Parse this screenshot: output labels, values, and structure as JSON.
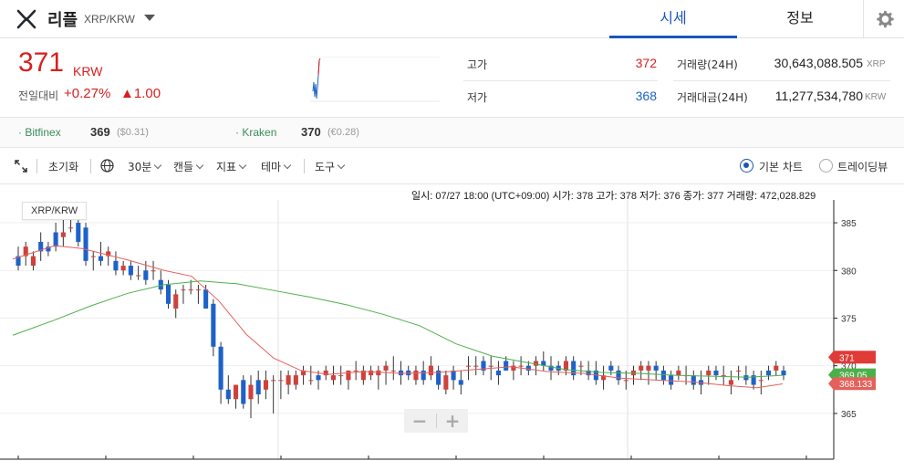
{
  "header": {
    "coin_name": "리플",
    "coin_pair": "XRP/KRW",
    "tabs": [
      {
        "label": "시세",
        "active": true
      },
      {
        "label": "정보",
        "active": false
      }
    ]
  },
  "price": {
    "current": "371",
    "unit": "KRW",
    "change_label": "전일대비",
    "change_pct": "+0.27%",
    "change_amt": "▲1.00"
  },
  "stats": {
    "high_label": "고가",
    "high": "372",
    "low_label": "저가",
    "low": "368",
    "volume_label": "거래량(24H)",
    "volume": "30,643,088.505",
    "volume_unit": "XRP",
    "value_label": "거래대금(24H)",
    "value": "11,277,534,780",
    "value_unit": "KRW"
  },
  "exchanges": [
    {
      "name": "Bitfinex",
      "price": "369",
      "sub": "($0.31)"
    },
    {
      "name": "Kraken",
      "price": "370",
      "sub": "(€0.28)"
    }
  ],
  "toolbar": {
    "reset": "초기화",
    "interval": "30분",
    "candle": "캔들",
    "indicator": "지표",
    "theme": "테마",
    "tools": "도구",
    "view_basic": "기본 차트",
    "view_tv": "트레이딩뷰"
  },
  "ohlc": {
    "time_label": "일시:",
    "time": "07/27 18:00 (UTC+09:00)",
    "open_label": "시가:",
    "open": "378",
    "high_label": "고가:",
    "high": "378",
    "low_label": "저가:",
    "low": "376",
    "close_label": "종가:",
    "close": "377",
    "vol_label": "거래량:",
    "vol": "472,028.829"
  },
  "colors": {
    "up": "#d0413b",
    "down": "#1e62c8",
    "ma_short": "#e5605a",
    "ma_long": "#4cb04a",
    "accent": "#1a56b8"
  },
  "chart_data": {
    "type": "candlestick",
    "symbol": "XRP/KRW",
    "ylim": [
      360.2,
      387.4
    ],
    "yticks": [
      365,
      370,
      375,
      380,
      385
    ],
    "price_tags": [
      {
        "label": "371",
        "value": 370.9,
        "color": "#e03b36"
      },
      {
        "label": "369.05",
        "value": 369.05,
        "color": "#4cb04a"
      },
      {
        "label": "368.133",
        "value": 368.13,
        "color": "#e5605a"
      }
    ],
    "candles": [
      [
        381.5,
        382.5,
        380.0,
        380.5
      ],
      [
        381.5,
        383.0,
        380.5,
        382.5
      ],
      [
        380.5,
        382.0,
        380.0,
        381.5
      ],
      [
        383.0,
        384.0,
        381.0,
        382.0
      ],
      [
        382.5,
        383.0,
        381.5,
        382.0
      ],
      [
        384.0,
        385.0,
        382.0,
        382.5
      ],
      [
        383.5,
        385.5,
        382.5,
        384.0
      ],
      [
        384.5,
        386.5,
        384.0,
        384.5
      ],
      [
        385.0,
        385.5,
        382.5,
        383.0
      ],
      [
        384.5,
        385.0,
        380.5,
        381.0
      ],
      [
        381.5,
        382.0,
        380.0,
        381.5
      ],
      [
        381.5,
        383.0,
        380.5,
        381.0
      ],
      [
        381.5,
        382.5,
        380.5,
        382.0
      ],
      [
        381.0,
        382.0,
        379.5,
        380.0
      ],
      [
        380.0,
        381.0,
        379.5,
        380.5
      ],
      [
        380.5,
        381.0,
        379.0,
        379.5
      ],
      [
        379.5,
        380.5,
        379.0,
        379.5
      ],
      [
        380.0,
        381.0,
        378.5,
        379.0
      ],
      [
        380.0,
        381.0,
        379.0,
        380.0
      ],
      [
        379.0,
        380.0,
        377.5,
        378.0
      ],
      [
        378.5,
        379.0,
        376.0,
        376.5
      ],
      [
        376.0,
        378.0,
        375.0,
        377.5
      ],
      [
        378.0,
        378.5,
        376.5,
        378.0
      ],
      [
        378.0,
        379.0,
        377.5,
        378.0
      ],
      [
        378.0,
        378.5,
        376.5,
        378.0
      ],
      [
        378.0,
        378.5,
        376.0,
        376.0
      ],
      [
        376.5,
        377.0,
        371.0,
        372.0
      ],
      [
        372.0,
        372.5,
        366.0,
        367.5
      ],
      [
        367.5,
        369.0,
        366.0,
        366.5
      ],
      [
        366.5,
        368.0,
        365.5,
        368.0
      ],
      [
        368.5,
        369.0,
        365.5,
        366.0
      ],
      [
        366.5,
        369.0,
        364.5,
        368.0
      ],
      [
        368.5,
        369.5,
        366.0,
        367.0
      ],
      [
        367.5,
        369.5,
        366.5,
        368.5
      ],
      [
        368.5,
        369.0,
        365.0,
        368.5
      ],
      [
        368.5,
        369.5,
        366.5,
        368.5
      ],
      [
        368.0,
        369.5,
        367.0,
        369.0
      ],
      [
        368.0,
        369.5,
        367.5,
        369.0
      ],
      [
        369.0,
        370.0,
        368.0,
        369.5
      ],
      [
        368.5,
        370.0,
        368.0,
        368.5
      ],
      [
        369.0,
        369.5,
        367.5,
        368.5
      ],
      [
        369.0,
        370.0,
        368.5,
        369.5
      ],
      [
        368.5,
        370.0,
        368.0,
        369.0
      ],
      [
        369.0,
        370.0,
        368.0,
        369.0
      ],
      [
        368.5,
        369.5,
        367.5,
        369.5
      ],
      [
        369.5,
        370.5,
        368.5,
        369.5
      ],
      [
        368.5,
        370.0,
        368.0,
        369.5
      ],
      [
        369.0,
        370.0,
        368.5,
        369.5
      ],
      [
        369.0,
        370.0,
        367.5,
        369.5
      ],
      [
        369.5,
        370.5,
        368.0,
        370.0
      ],
      [
        369.5,
        371.0,
        368.5,
        369.5
      ],
      [
        369.5,
        370.5,
        368.0,
        369.0
      ],
      [
        369.5,
        370.0,
        368.5,
        369.0
      ],
      [
        368.5,
        370.0,
        368.0,
        369.5
      ],
      [
        369.5,
        370.5,
        368.0,
        368.5
      ],
      [
        369.0,
        371.0,
        368.5,
        370.0
      ],
      [
        369.5,
        370.0,
        367.5,
        368.0
      ],
      [
        367.5,
        369.5,
        367.0,
        369.0
      ],
      [
        369.5,
        370.0,
        367.5,
        368.5
      ],
      [
        368.5,
        369.5,
        367.0,
        368.0
      ],
      [
        370.0,
        371.0,
        368.5,
        370.0
      ],
      [
        370.0,
        371.0,
        369.0,
        370.0
      ],
      [
        370.5,
        371.0,
        369.0,
        369.5
      ],
      [
        370.0,
        371.0,
        368.5,
        370.0
      ],
      [
        369.5,
        370.5,
        368.0,
        369.0
      ],
      [
        370.5,
        371.0,
        369.5,
        369.5
      ],
      [
        369.5,
        370.5,
        368.5,
        370.0
      ],
      [
        370.0,
        371.0,
        369.0,
        370.0
      ],
      [
        370.0,
        370.5,
        369.0,
        369.5
      ],
      [
        370.0,
        371.0,
        369.0,
        370.5
      ],
      [
        370.5,
        371.5,
        369.5,
        370.0
      ],
      [
        370.0,
        371.0,
        368.5,
        369.5
      ],
      [
        370.0,
        370.5,
        369.0,
        369.5
      ],
      [
        369.5,
        371.0,
        369.0,
        370.5
      ],
      [
        370.5,
        371.0,
        368.5,
        369.0
      ],
      [
        370.0,
        370.5,
        369.0,
        370.0
      ],
      [
        369.5,
        370.5,
        368.5,
        369.0
      ],
      [
        369.5,
        370.5,
        368.0,
        368.5
      ],
      [
        368.5,
        370.0,
        367.5,
        369.0
      ],
      [
        370.0,
        370.5,
        369.0,
        369.5
      ],
      [
        369.5,
        370.0,
        368.0,
        368.5
      ],
      [
        368.5,
        369.5,
        367.5,
        368.5
      ],
      [
        369.0,
        370.0,
        368.0,
        369.5
      ],
      [
        369.5,
        370.5,
        368.5,
        370.0
      ],
      [
        369.5,
        370.5,
        368.0,
        370.0
      ],
      [
        370.0,
        370.5,
        368.5,
        369.5
      ],
      [
        369.5,
        370.0,
        368.0,
        368.5
      ],
      [
        369.0,
        369.5,
        367.5,
        368.0
      ],
      [
        369.0,
        370.0,
        368.5,
        369.5
      ],
      [
        369.0,
        370.0,
        368.0,
        369.0
      ],
      [
        369.0,
        369.5,
        367.5,
        368.0
      ],
      [
        368.5,
        369.5,
        367.0,
        368.0
      ],
      [
        369.0,
        370.0,
        368.0,
        369.5
      ],
      [
        369.5,
        370.0,
        368.5,
        369.0
      ],
      [
        369.0,
        370.0,
        368.0,
        369.0
      ],
      [
        368.0,
        369.5,
        367.0,
        368.5
      ],
      [
        369.5,
        370.0,
        368.5,
        369.5
      ],
      [
        369.0,
        370.0,
        368.0,
        368.5
      ],
      [
        369.0,
        369.5,
        367.5,
        368.0
      ],
      [
        368.5,
        369.5,
        367.0,
        368.5
      ],
      [
        369.5,
        370.0,
        368.5,
        369.0
      ],
      [
        369.5,
        370.5,
        369.0,
        370.0
      ],
      [
        369.5,
        370.0,
        368.5,
        369.0
      ]
    ],
    "ma_short": [
      [
        14,
        381.2
      ],
      [
        60,
        382.6
      ],
      [
        90,
        382.3
      ],
      [
        140,
        381.1
      ],
      [
        180,
        380.0
      ],
      [
        210,
        379.4
      ],
      [
        240,
        376.8
      ],
      [
        270,
        373.3
      ],
      [
        300,
        370.8
      ],
      [
        330,
        369.5
      ],
      [
        360,
        369.1
      ],
      [
        400,
        369.4
      ],
      [
        440,
        369.2
      ],
      [
        480,
        369.3
      ],
      [
        520,
        369.6
      ],
      [
        560,
        369.9
      ],
      [
        600,
        369.4
      ],
      [
        640,
        369.2
      ],
      [
        680,
        368.7
      ],
      [
        720,
        368.5
      ],
      [
        760,
        368.3
      ],
      [
        800,
        367.9
      ],
      [
        830,
        367.7
      ],
      [
        858,
        368.1
      ]
    ],
    "ma_long": [
      [
        14,
        373.2
      ],
      [
        60,
        374.8
      ],
      [
        100,
        376.3
      ],
      [
        140,
        377.6
      ],
      [
        180,
        378.5
      ],
      [
        220,
        378.9
      ],
      [
        260,
        378.6
      ],
      [
        300,
        377.9
      ],
      [
        340,
        377.2
      ],
      [
        380,
        376.4
      ],
      [
        420,
        375.4
      ],
      [
        460,
        374.2
      ],
      [
        500,
        372.3
      ],
      [
        540,
        371.0
      ],
      [
        580,
        370.3
      ],
      [
        620,
        369.6
      ],
      [
        660,
        369.3
      ],
      [
        700,
        369.2
      ],
      [
        740,
        369.0
      ],
      [
        780,
        368.9
      ],
      [
        820,
        368.8
      ],
      [
        858,
        369.0
      ]
    ]
  }
}
